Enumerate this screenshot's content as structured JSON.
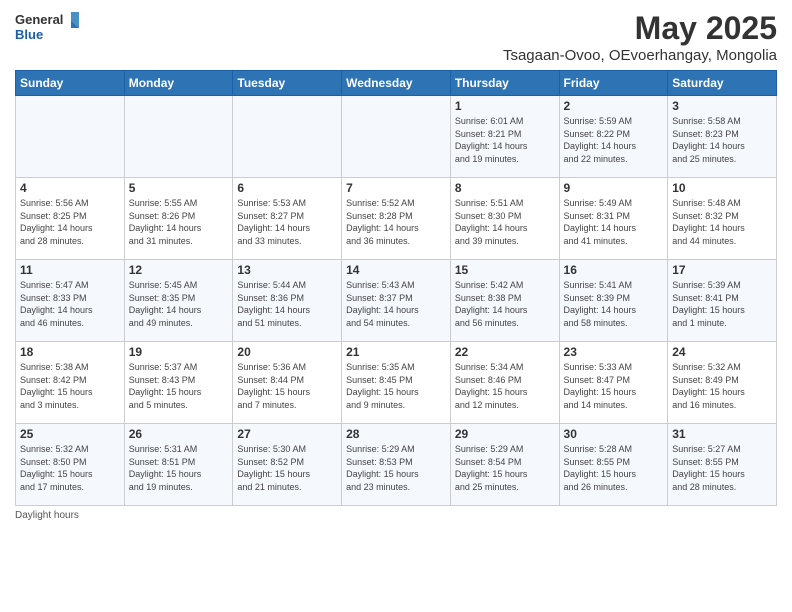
{
  "logo": {
    "general": "General",
    "blue": "Blue"
  },
  "title": "May 2025",
  "subtitle": "Tsagaan-Ovoo, OEvoerhangay, Mongolia",
  "header_days": [
    "Sunday",
    "Monday",
    "Tuesday",
    "Wednesday",
    "Thursday",
    "Friday",
    "Saturday"
  ],
  "weeks": [
    [
      {
        "day": "",
        "info": ""
      },
      {
        "day": "",
        "info": ""
      },
      {
        "day": "",
        "info": ""
      },
      {
        "day": "",
        "info": ""
      },
      {
        "day": "1",
        "info": "Sunrise: 6:01 AM\nSunset: 8:21 PM\nDaylight: 14 hours\nand 19 minutes."
      },
      {
        "day": "2",
        "info": "Sunrise: 5:59 AM\nSunset: 8:22 PM\nDaylight: 14 hours\nand 22 minutes."
      },
      {
        "day": "3",
        "info": "Sunrise: 5:58 AM\nSunset: 8:23 PM\nDaylight: 14 hours\nand 25 minutes."
      }
    ],
    [
      {
        "day": "4",
        "info": "Sunrise: 5:56 AM\nSunset: 8:25 PM\nDaylight: 14 hours\nand 28 minutes."
      },
      {
        "day": "5",
        "info": "Sunrise: 5:55 AM\nSunset: 8:26 PM\nDaylight: 14 hours\nand 31 minutes."
      },
      {
        "day": "6",
        "info": "Sunrise: 5:53 AM\nSunset: 8:27 PM\nDaylight: 14 hours\nand 33 minutes."
      },
      {
        "day": "7",
        "info": "Sunrise: 5:52 AM\nSunset: 8:28 PM\nDaylight: 14 hours\nand 36 minutes."
      },
      {
        "day": "8",
        "info": "Sunrise: 5:51 AM\nSunset: 8:30 PM\nDaylight: 14 hours\nand 39 minutes."
      },
      {
        "day": "9",
        "info": "Sunrise: 5:49 AM\nSunset: 8:31 PM\nDaylight: 14 hours\nand 41 minutes."
      },
      {
        "day": "10",
        "info": "Sunrise: 5:48 AM\nSunset: 8:32 PM\nDaylight: 14 hours\nand 44 minutes."
      }
    ],
    [
      {
        "day": "11",
        "info": "Sunrise: 5:47 AM\nSunset: 8:33 PM\nDaylight: 14 hours\nand 46 minutes."
      },
      {
        "day": "12",
        "info": "Sunrise: 5:45 AM\nSunset: 8:35 PM\nDaylight: 14 hours\nand 49 minutes."
      },
      {
        "day": "13",
        "info": "Sunrise: 5:44 AM\nSunset: 8:36 PM\nDaylight: 14 hours\nand 51 minutes."
      },
      {
        "day": "14",
        "info": "Sunrise: 5:43 AM\nSunset: 8:37 PM\nDaylight: 14 hours\nand 54 minutes."
      },
      {
        "day": "15",
        "info": "Sunrise: 5:42 AM\nSunset: 8:38 PM\nDaylight: 14 hours\nand 56 minutes."
      },
      {
        "day": "16",
        "info": "Sunrise: 5:41 AM\nSunset: 8:39 PM\nDaylight: 14 hours\nand 58 minutes."
      },
      {
        "day": "17",
        "info": "Sunrise: 5:39 AM\nSunset: 8:41 PM\nDaylight: 15 hours\nand 1 minute."
      }
    ],
    [
      {
        "day": "18",
        "info": "Sunrise: 5:38 AM\nSunset: 8:42 PM\nDaylight: 15 hours\nand 3 minutes."
      },
      {
        "day": "19",
        "info": "Sunrise: 5:37 AM\nSunset: 8:43 PM\nDaylight: 15 hours\nand 5 minutes."
      },
      {
        "day": "20",
        "info": "Sunrise: 5:36 AM\nSunset: 8:44 PM\nDaylight: 15 hours\nand 7 minutes."
      },
      {
        "day": "21",
        "info": "Sunrise: 5:35 AM\nSunset: 8:45 PM\nDaylight: 15 hours\nand 9 minutes."
      },
      {
        "day": "22",
        "info": "Sunrise: 5:34 AM\nSunset: 8:46 PM\nDaylight: 15 hours\nand 12 minutes."
      },
      {
        "day": "23",
        "info": "Sunrise: 5:33 AM\nSunset: 8:47 PM\nDaylight: 15 hours\nand 14 minutes."
      },
      {
        "day": "24",
        "info": "Sunrise: 5:32 AM\nSunset: 8:49 PM\nDaylight: 15 hours\nand 16 minutes."
      }
    ],
    [
      {
        "day": "25",
        "info": "Sunrise: 5:32 AM\nSunset: 8:50 PM\nDaylight: 15 hours\nand 17 minutes."
      },
      {
        "day": "26",
        "info": "Sunrise: 5:31 AM\nSunset: 8:51 PM\nDaylight: 15 hours\nand 19 minutes."
      },
      {
        "day": "27",
        "info": "Sunrise: 5:30 AM\nSunset: 8:52 PM\nDaylight: 15 hours\nand 21 minutes."
      },
      {
        "day": "28",
        "info": "Sunrise: 5:29 AM\nSunset: 8:53 PM\nDaylight: 15 hours\nand 23 minutes."
      },
      {
        "day": "29",
        "info": "Sunrise: 5:29 AM\nSunset: 8:54 PM\nDaylight: 15 hours\nand 25 minutes."
      },
      {
        "day": "30",
        "info": "Sunrise: 5:28 AM\nSunset: 8:55 PM\nDaylight: 15 hours\nand 26 minutes."
      },
      {
        "day": "31",
        "info": "Sunrise: 5:27 AM\nSunset: 8:55 PM\nDaylight: 15 hours\nand 28 minutes."
      }
    ]
  ],
  "footer": "Daylight hours"
}
